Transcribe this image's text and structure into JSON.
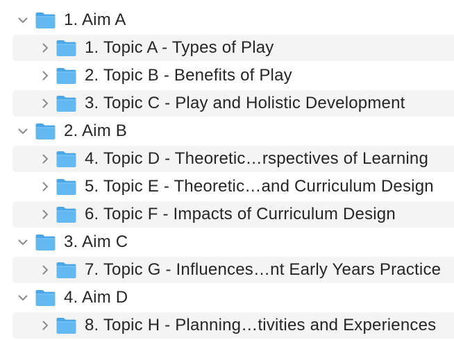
{
  "tree": [
    {
      "label": "1. Aim A",
      "level": 0,
      "expanded": true,
      "striped": false
    },
    {
      "label": "1. Topic A - Types of Play",
      "level": 1,
      "expanded": false,
      "striped": true
    },
    {
      "label": "2. Topic B - Benefits of Play",
      "level": 1,
      "expanded": false,
      "striped": false
    },
    {
      "label": "3. Topic C - Play and Holistic Development",
      "level": 1,
      "expanded": false,
      "striped": true
    },
    {
      "label": "2. Aim B",
      "level": 0,
      "expanded": true,
      "striped": false
    },
    {
      "label": "4. Topic D - Theoretic…rspectives of Learning",
      "level": 1,
      "expanded": false,
      "striped": true
    },
    {
      "label": "5. Topic E - Theoretic…and Curriculum Design",
      "level": 1,
      "expanded": false,
      "striped": false
    },
    {
      "label": "6. Topic F - Impacts of Curriculum Design",
      "level": 1,
      "expanded": false,
      "striped": true
    },
    {
      "label": "3. Aim C",
      "level": 0,
      "expanded": true,
      "striped": false
    },
    {
      "label": "7. Topic G - Influences…nt Early Years Practice",
      "level": 1,
      "expanded": false,
      "striped": true
    },
    {
      "label": "4. Aim D",
      "level": 0,
      "expanded": true,
      "striped": false
    },
    {
      "label": "8. Topic H - Planning…tivities and Experiences",
      "level": 1,
      "expanded": false,
      "striped": true
    }
  ],
  "icons": {
    "folder": "folder-icon",
    "expanded": "chevron-down-icon",
    "collapsed": "chevron-right-icon"
  },
  "colors": {
    "folder_body": "#62b8f0",
    "folder_tab": "#4aa6e6",
    "chevron": "#8a8a8e",
    "stripe": "#f4f4f5",
    "text": "#262626"
  }
}
